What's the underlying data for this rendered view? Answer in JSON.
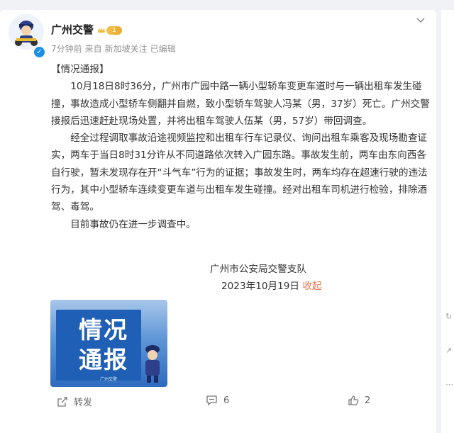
{
  "post": {
    "author": "广州交警",
    "level": "1",
    "meta": {
      "time": "7分钟前",
      "source_prefix": "来自",
      "source": "新加坡关注",
      "edited": "已编辑"
    },
    "title": "【情况通报】",
    "paragraphs": [
      "10月18日8时36分，广州市广园中路一辆小型轿车变更车道时与一辆出租车发生碰撞，事故造成小型轿车侧翻并自燃，致小型轿车驾驶人冯某（男，37岁）死亡。广州交警接报后迅速赶赴现场处置，并将出租车驾驶人伍某（男，57岁）带回调查。",
      "经全过程调取事故沿途视频监控和出租车行车记录仪、询问出租车乘客及现场勘查证实，两车于当日8时31分许从不同道路依次转入广园东路。事故发生前，两车由东向西各自行驶，暂未发现存在开“斗气车”行为的证据；事故发生时，两车均存在超速行驶的违法行为，其中小型轿车连续变更车道与出租车发生碰撞。经对出租车司机进行检验，排除酒驾、毒驾。",
      "目前事故仍在进一步调查中。"
    ],
    "signature": "广州市公安局交警支队",
    "date": "2023年10月19日",
    "collapse": "收起",
    "image": {
      "line1": "情况",
      "line2": "通报",
      "caption": "广州交警"
    }
  },
  "actions": {
    "repost": "转发",
    "comments": "6",
    "likes": "2"
  },
  "colors": {
    "link": "#eb7350",
    "verify": "#1a8fe3",
    "thumb": "#2f6bbf"
  }
}
